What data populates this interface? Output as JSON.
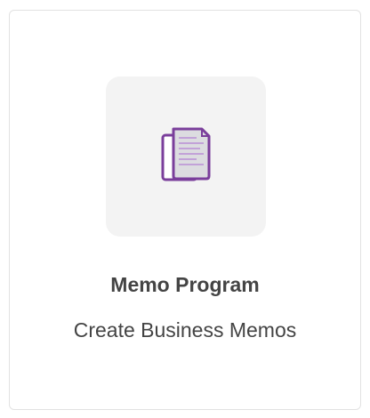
{
  "card": {
    "title": "Memo Program",
    "subtitle": "Create Business Memos",
    "icon": "documents-icon"
  },
  "colors": {
    "icon_accent": "#7a3e9b",
    "icon_page": "#dcdce0",
    "icon_lines": "#b98fd6",
    "tile_background": "#f3f3f3",
    "text": "#444444",
    "border": "#e2e2e2"
  }
}
